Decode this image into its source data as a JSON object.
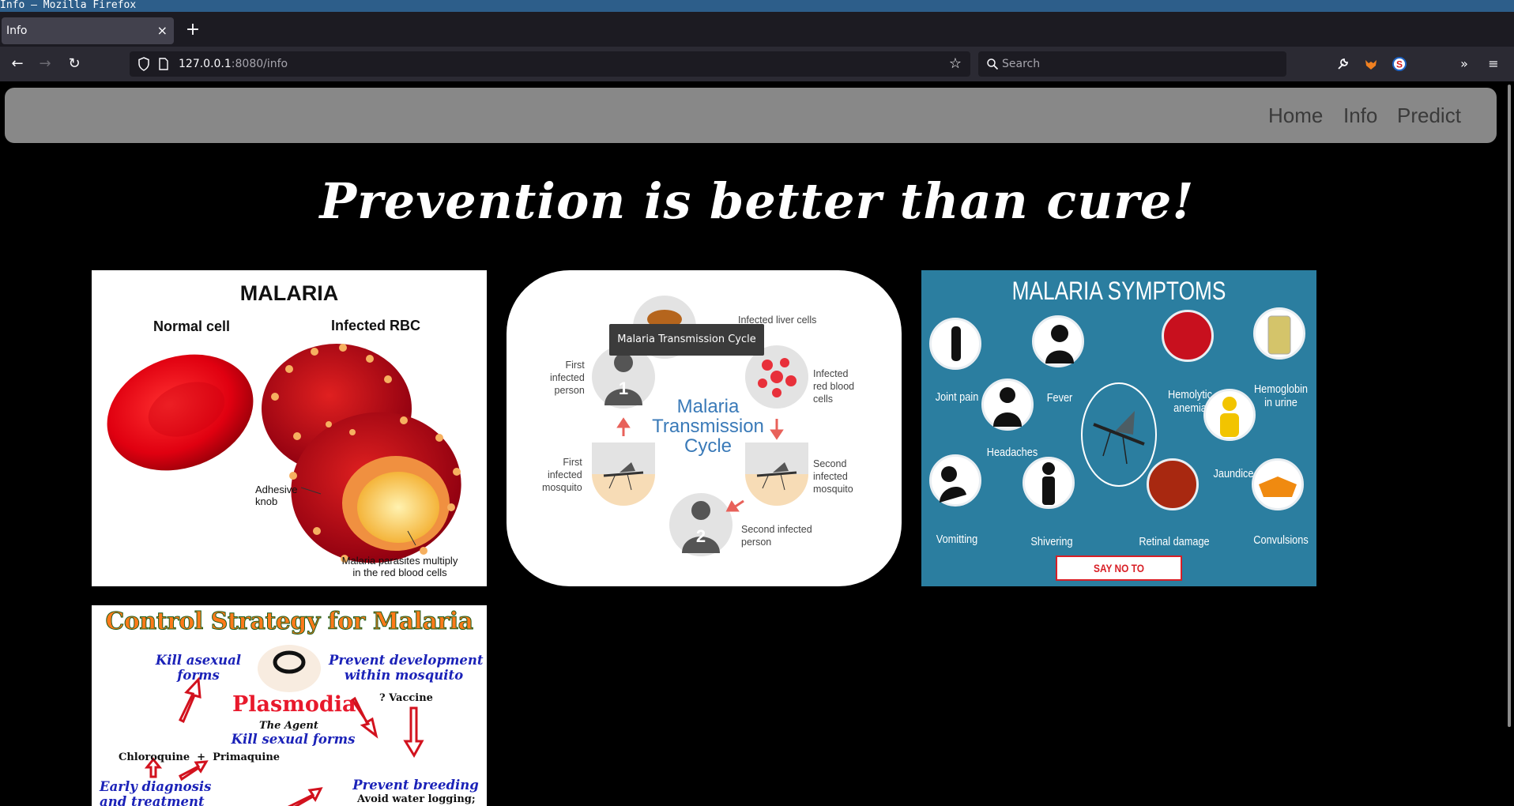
{
  "window": {
    "title": "Info — Mozilla Firefox"
  },
  "browser": {
    "tab": {
      "title": "Info",
      "close": "×"
    },
    "new_tab": "+",
    "url": {
      "host": "127.0.0.1",
      "rest": ":8080/info"
    },
    "search_placeholder": "Search"
  },
  "site_nav": {
    "links": [
      "Home",
      "Info",
      "Predict"
    ]
  },
  "headline": "Prevention is better than cure!",
  "cards": {
    "malaria": {
      "title": "MALARIA",
      "normal_cell": "Normal cell",
      "infected_rbc": "Infected RBC",
      "adhesive_knob": "Adhesive\nknob",
      "parasites": "Malaria parasites multiply\nin the red blood cells"
    },
    "cycle": {
      "tooltip": "Malaria Transmission Cycle",
      "center": "Malaria\nTransmission\nCycle",
      "labels": {
        "liver": "Infected liver cells",
        "rbc": "Infected\nred blood\ncells",
        "second_mosquito": "Second\ninfected\nmosquito",
        "second_person": "Second infected\nperson",
        "first_mosquito": "First\ninfected\nmosquito",
        "first_person": "First\ninfected\nperson"
      },
      "numbers": [
        "1",
        "2"
      ]
    },
    "symptoms": {
      "title": "MALARIA SYMPTOMS",
      "items": {
        "joint_pain": "Joint pain",
        "fever": "Fever",
        "headaches": "Headaches",
        "hemolytic": "Hemolytic\nanemia",
        "hemoglobin": "Hemoglobin\nin urine",
        "jaundice": "Jaundice",
        "vomitting": "Vomitting",
        "shivering": "Shivering",
        "retinal": "Retinal damage",
        "convulsions": "Convulsions"
      },
      "banner": "SAY NO TO MOSQUITOES"
    },
    "control": {
      "title": "Control Strategy for Malaria",
      "kill_asexual": "Kill asexual\nforms",
      "prevent_dev": "Prevent development\nwithin mosquito",
      "plasmodia": "Plasmodia",
      "the_agent": "The Agent",
      "kill_sexual": "Kill sexual forms",
      "vaccine": "? Vaccine",
      "chloroquine": "Chloroquine  +  Primaquine",
      "early": "Early diagnosis\nand treatment",
      "prevent_breeding": "Prevent breeding",
      "avoid": "Avoid water logging;"
    }
  }
}
